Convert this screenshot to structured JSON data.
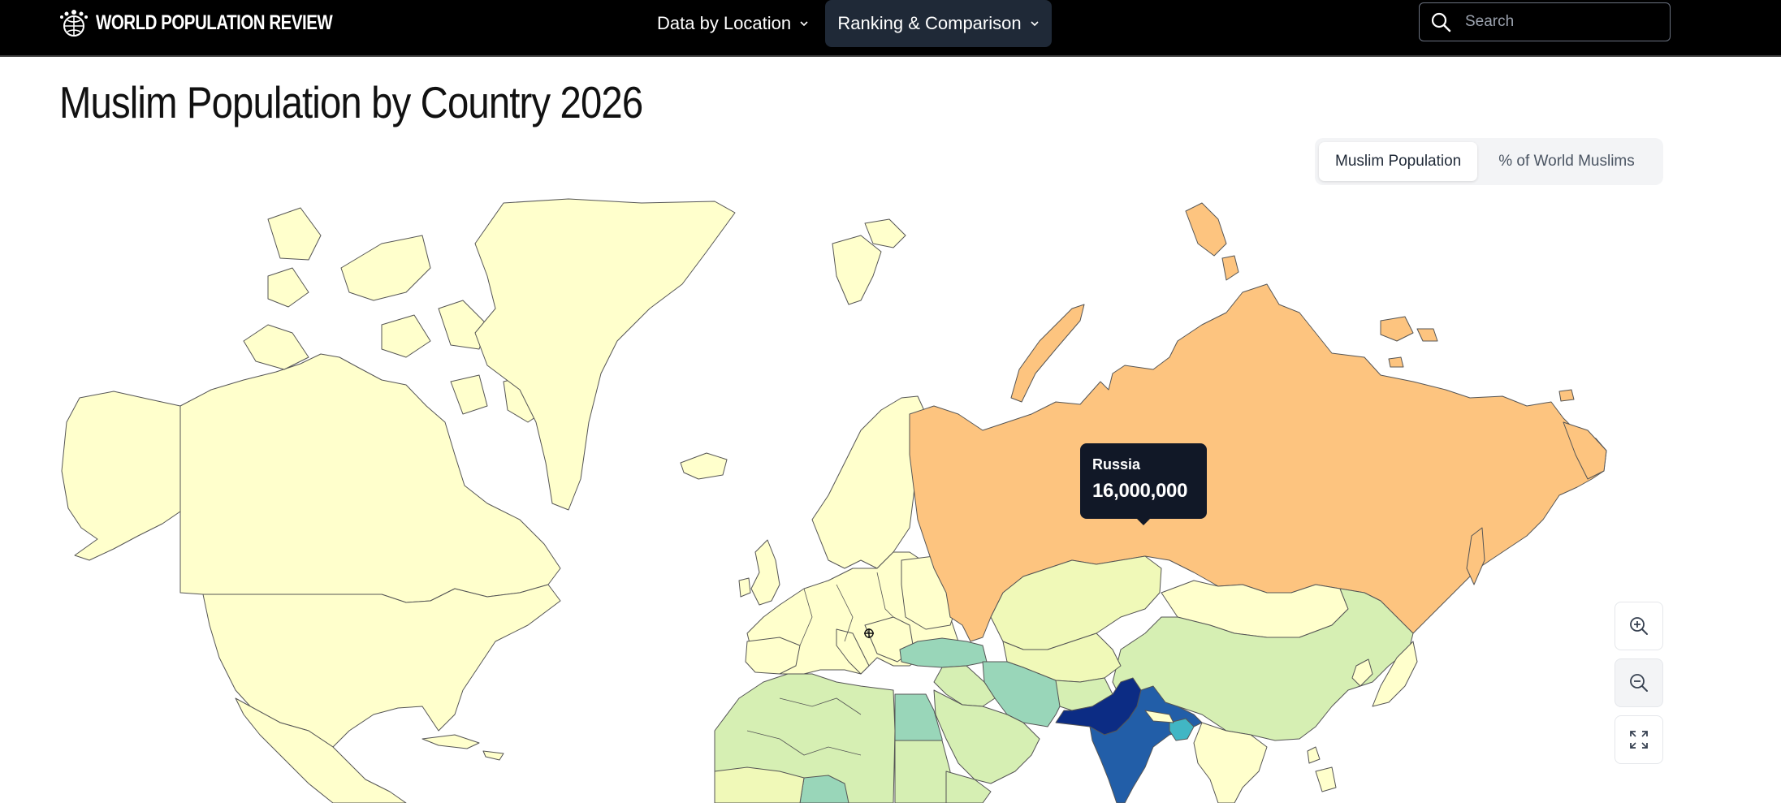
{
  "header": {
    "logo_text": "WORLD POPULATION REVIEW",
    "logo_icon": "people-globe-icon",
    "nav": [
      {
        "label": "Data by Location",
        "icon": "chevron-down-icon"
      },
      {
        "label": "Ranking & Comparison",
        "icon": "chevron-down-icon",
        "active": true
      }
    ],
    "search": {
      "placeholder": "Search",
      "value": "",
      "icon": "search-icon"
    }
  },
  "page": {
    "title": "Muslim Population by Country 2026"
  },
  "toggle": {
    "options": [
      "Muslim Population",
      "% of World Muslims"
    ],
    "selected": "Muslim Population"
  },
  "map": {
    "tooltip": {
      "country": "Russia",
      "value": "16,000,000"
    },
    "controls": [
      "zoom-in-icon",
      "zoom-out-icon",
      "fullscreen-icon"
    ],
    "colors": {
      "lowest": "#ffffcc",
      "very_low": "#f0f9b8",
      "low": "#d6efb3",
      "mid": "#99d6b9",
      "mid_high": "#41b6c4",
      "high": "#225ea8",
      "highest": "#0c2c84",
      "hover": "#fdc47f",
      "border": "#555555"
    }
  }
}
